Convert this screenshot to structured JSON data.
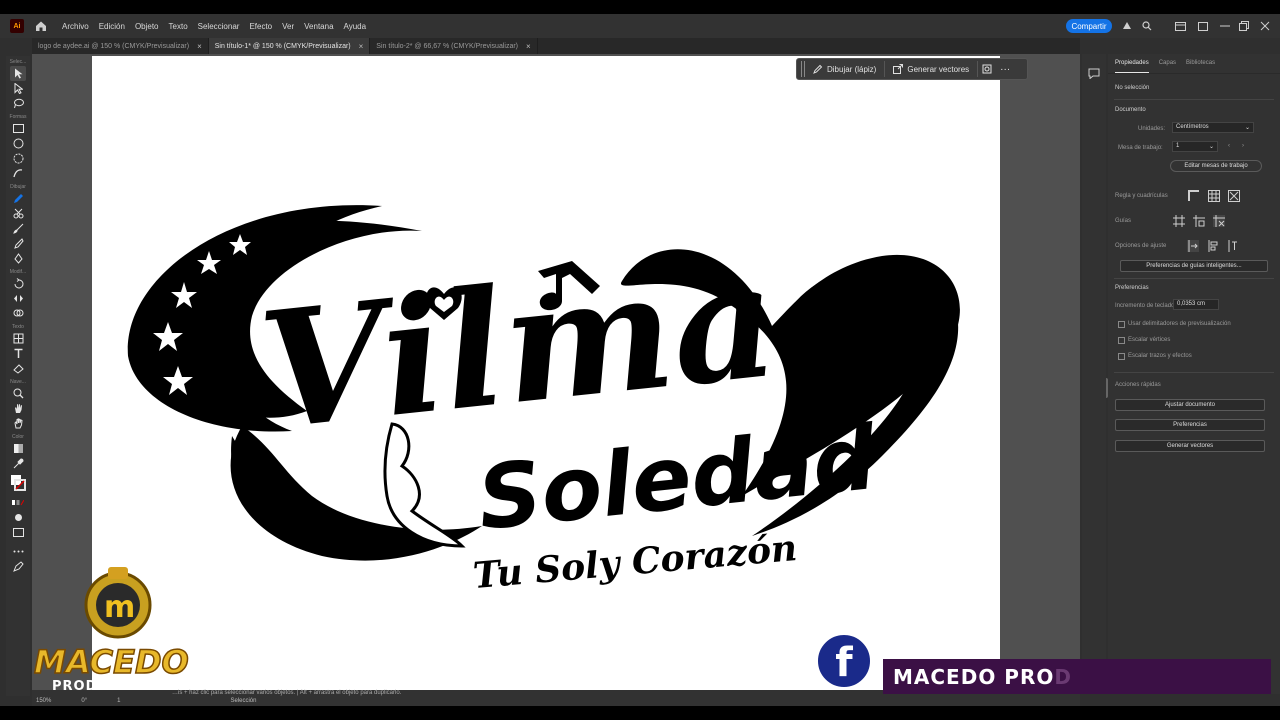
{
  "menu": {
    "items": [
      "Archivo",
      "Edición",
      "Objeto",
      "Texto",
      "Seleccionar",
      "Efecto",
      "Ver",
      "Ventana",
      "Ayuda"
    ],
    "share_label": "Compartir",
    "app_badge": "Ai"
  },
  "tabs": [
    {
      "label": "logo de aydee.ai @ 150 % (CMYK/Previsualizar)",
      "close": "×"
    },
    {
      "label": "Sin título-1* @ 150 % (CMYK/Previsualizar)",
      "close": "×"
    },
    {
      "label": "Sin título-2* @ 66,67 % (CMYK/Previsualizar)",
      "close": "×"
    }
  ],
  "toolbar": {
    "groups": [
      "Selec...",
      "Formas",
      "Dibujar",
      "Modif...",
      "Texto",
      "Nave...",
      "Color"
    ]
  },
  "context_bar": {
    "draw_label": "Dibujar (lápiz)",
    "vectorize_label": "Generar vectores",
    "more": "···"
  },
  "artwork": {
    "title_line1": "Vilma",
    "title_line2": "Soledad",
    "tagline": "Tu Soly Corazón"
  },
  "panel": {
    "tabs": [
      "Propiedades",
      "Capas",
      "Bibliotecas"
    ],
    "no_selection": "No selección",
    "document_header": "Documento",
    "units_label": "Unidades:",
    "units_value": "Centímetros",
    "artboard_label": "Mesa de trabajo:",
    "artboard_value": "1",
    "edit_artboards": "Editar mesas de trabajo",
    "rulers_label": "Regla y cuadrículas",
    "guides_label": "Guías",
    "snap_label": "Opciones de ajuste",
    "smart_guides_btn": "Preferencias de guías inteligentes...",
    "preferences_header": "Preferencias",
    "keyboard_inc_label": "Incremento de teclado:",
    "keyboard_inc_value": "0,0353 cm",
    "check_preview_bounds": "Usar delimitadores de previsualización",
    "check_scale_corners": "Escalar vértices",
    "check_scale_strokes": "Escalar trazos y efectos",
    "quick_actions_header": "Acciones rápidas",
    "btn_fit_doc": "Ajustar documento",
    "btn_prefs": "Preferencias",
    "btn_vectors": "Generar vectores"
  },
  "status": {
    "hint": "…is + haz clic para seleccionar varios objetos. | Alt + arrastra el objeto para duplicarlo.",
    "zoom": "150%",
    "rotation": "0°",
    "artboard_num": "1",
    "mode": "Selección"
  },
  "watermark": {
    "logo_text": "MACEDO",
    "produc_text": "PRODUCCIONES",
    "banner_text": "MACEDO PRO",
    "banner_fade": "D",
    "fb_letter": "f"
  },
  "colors": {
    "accent": "#1473e6",
    "banner": "#3b1045",
    "fb": "#1a2a8a"
  }
}
